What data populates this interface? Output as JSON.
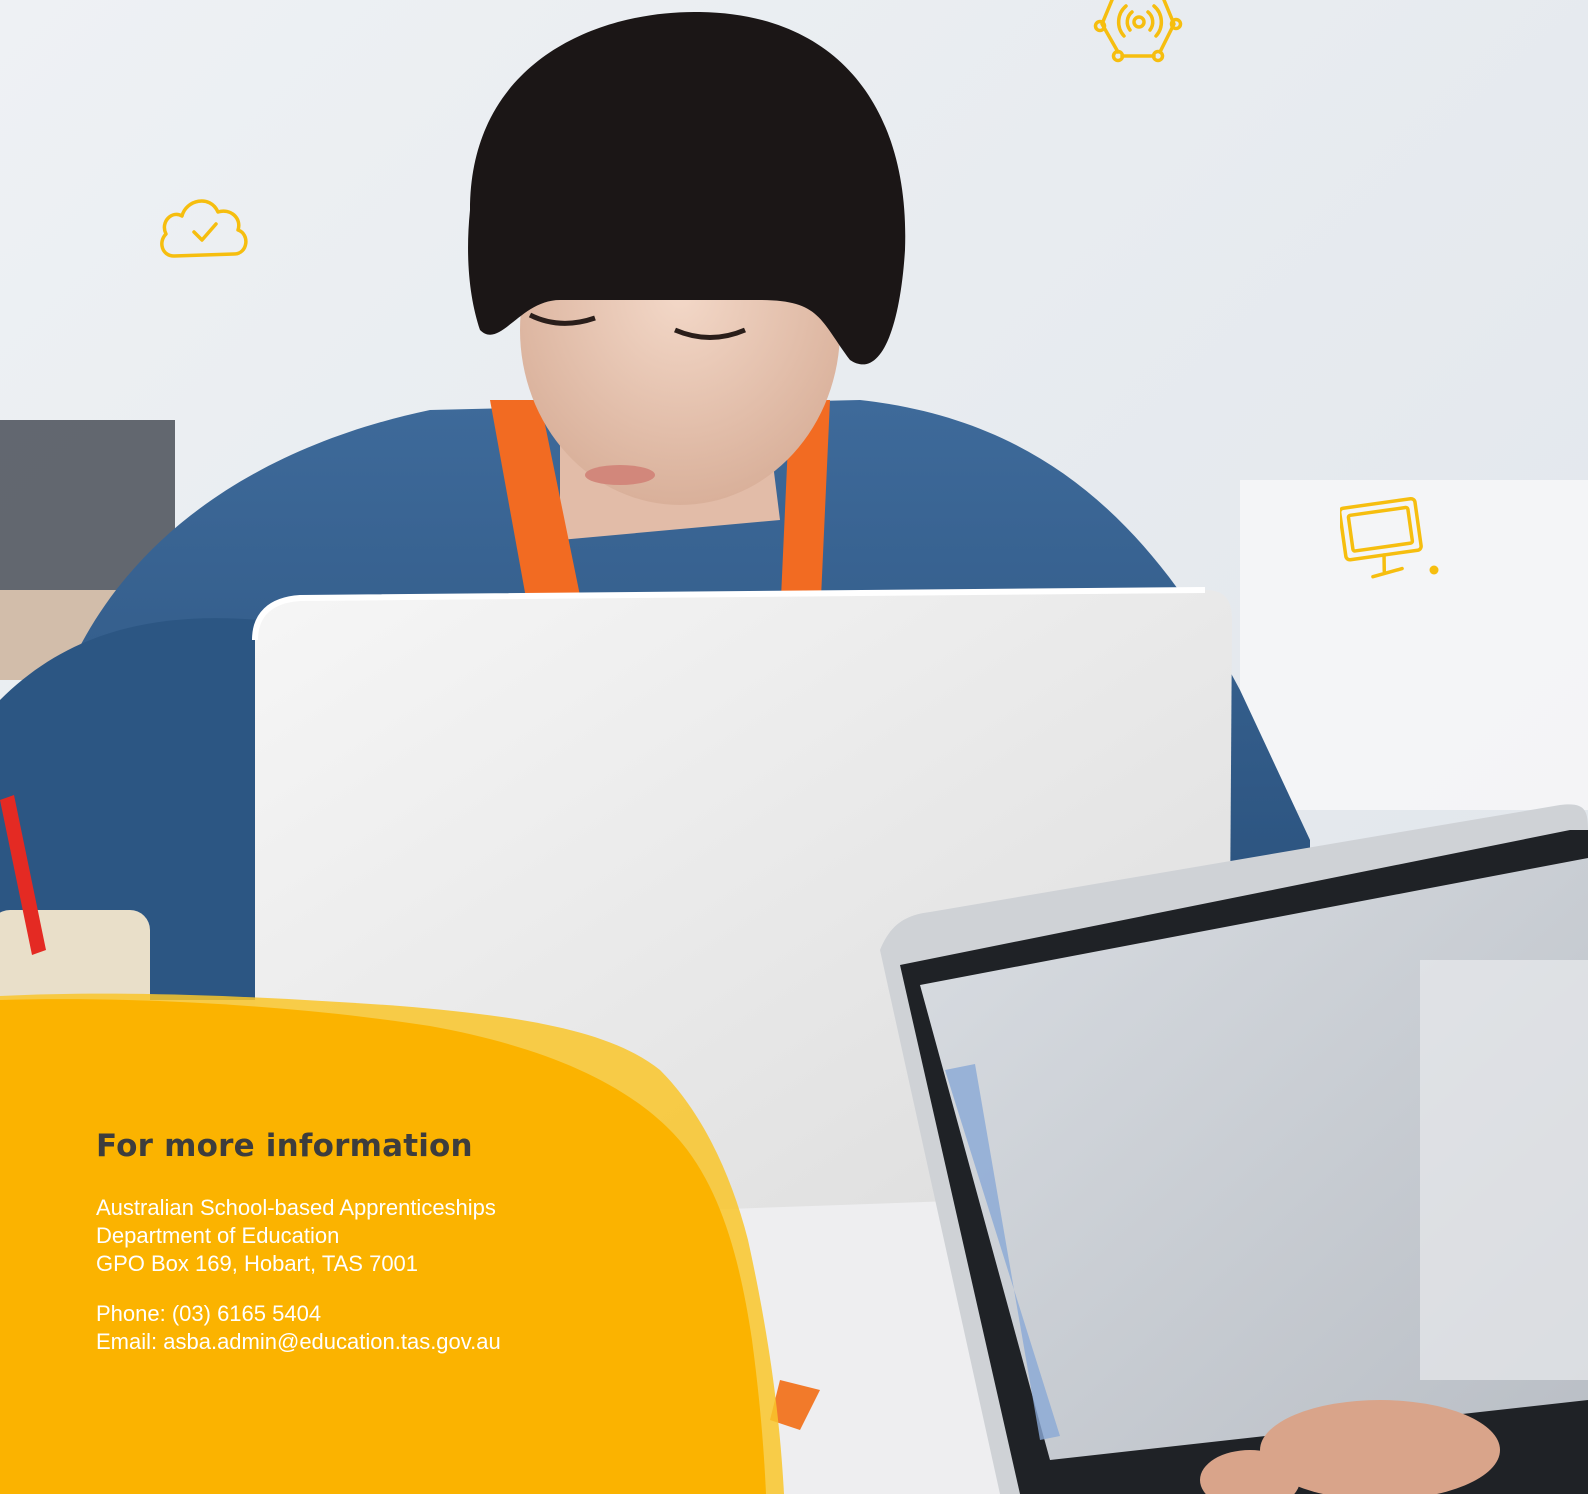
{
  "info": {
    "title": "For more information",
    "address": [
      "Australian School-based Apprenticeships",
      "Department of Education",
      "GPO Box 169, Hobart, TAS 7001"
    ],
    "phone": "Phone: (03) 6165 5404",
    "email_prefix": "Email: ",
    "email": "asba.admin@education.tas.gov.au"
  },
  "colors": {
    "accent_yellow": "#FBB300",
    "icon_yellow": "#F6BE0F",
    "title_gray": "#3D3D3D",
    "text_white": "#FFFFFF"
  },
  "icons": [
    "network-hexagon-icon",
    "cloud-check-icon",
    "desktop-monitor-icon"
  ]
}
